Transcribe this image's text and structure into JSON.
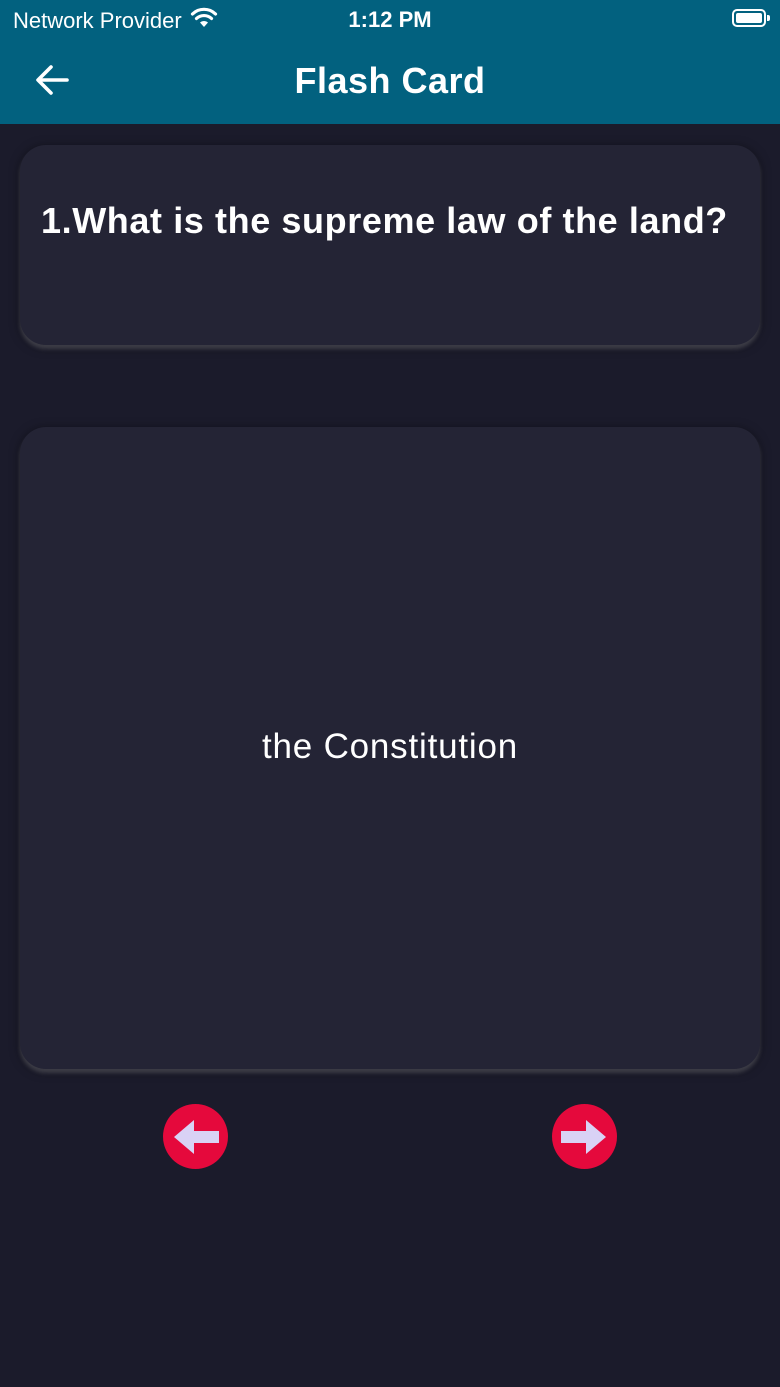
{
  "status_bar": {
    "carrier": "Network Provider",
    "time": "1:12 PM",
    "wifi_icon": "wifi-icon",
    "battery_icon": "battery-icon"
  },
  "header": {
    "title": "Flash Card",
    "back_icon": "arrow-left-icon"
  },
  "question": {
    "text": "1.What is the supreme law of the land?"
  },
  "answer": {
    "text": "the Constitution"
  },
  "controls": {
    "prev_icon": "arrow-left-circle-icon",
    "next_icon": "arrow-right-circle-icon"
  },
  "colors": {
    "header_background": "#02617f",
    "page_background": "#1b1b2b",
    "card_background": "#242435",
    "accent_red": "#e5093c",
    "arrow_fill": "#d9d2f5"
  }
}
